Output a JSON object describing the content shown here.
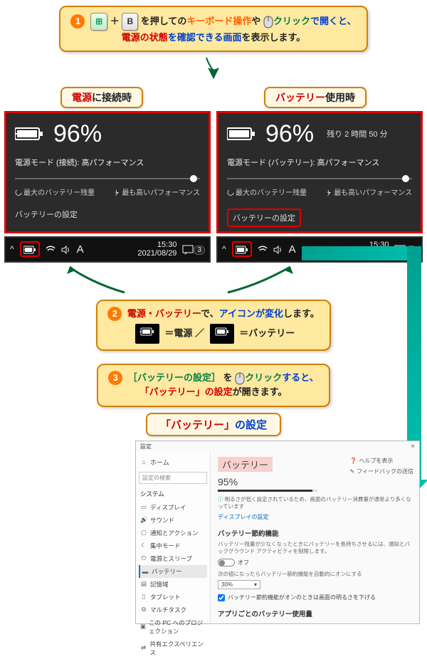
{
  "callout1": {
    "prefix": " を押しての",
    "kb_op": "キーボード操作",
    "ya": "や ",
    "click": "クリック",
    "de_open": "で開くと、",
    "line2a": "電源の状態",
    "line2b": "を確認できる画面",
    "line2c": "を表示します。"
  },
  "labels": {
    "plugged": "電源",
    "plugged_suffix": "に接続時",
    "battery": "バッテリー",
    "battery_suffix": "使用時"
  },
  "panelA": {
    "percent": "96%",
    "mode": "電源モード (接続): 高パフォーマンス",
    "left_label": "最大のバッテリー残量",
    "right_label": "最も高いパフォーマンス",
    "settings_link": "バッテリーの設定"
  },
  "panelB": {
    "percent": "96%",
    "remaining": "残り 2 時間 50 分",
    "mode": "電源モード (バッテリー): 高パフォーマンス",
    "left_label": "最大のバッテリー残量",
    "right_label": "最も高いパフォーマンス",
    "settings_link": "バッテリーの設定"
  },
  "taskbar": {
    "time": "15:30",
    "date": "2021/08/29",
    "ime": "A",
    "badge": "3"
  },
  "callout2": {
    "lead": "電源・バッテリー",
    "de": "で、",
    "icon_change": "アイコンが変化",
    "shimasu": "します。",
    "eq_power": " ＝電源  ／  ",
    "eq_batt": " ＝バッテリー"
  },
  "callout3": {
    "open_br": "［",
    "link_name": "バッテリーの設定",
    "close_br": "］",
    "wo": " を ",
    "click": "クリック",
    "suruto": "すると、",
    "line2a": "「",
    "line2b": "バッテリー",
    "line2c": "」の設定",
    "line2d": "が開きます。"
  },
  "settings_label": {
    "a": "「",
    "b": "バッテリー",
    "c": "」",
    "d": "の設定"
  },
  "settings": {
    "win_title": "設定",
    "close": "×",
    "home": "ホーム",
    "search_placeholder": "設定の検索",
    "section": "システム",
    "side_items": [
      "ディスプレイ",
      "サウンド",
      "通知とアクション",
      "集中モード",
      "電源とスリープ",
      "バッテリー",
      "記憶域",
      "タブレット",
      "マルチタスク",
      "この PC へのプロジェクション",
      "共有エクスペリエンス"
    ],
    "main_title": "バッテリー",
    "percent": "95%",
    "progress_pct": 95,
    "info_note": "明るさが低く設定されているため、画面のバッテリー消費量が通常より多くなっています",
    "display_settings_link": "ディスプレイの設定",
    "saver_head": "バッテリー節約機能",
    "saver_note": "バッテリー残量が少なくなったときにバッテリーを長持ちさせるには、通知とバックグラウンド アクティビティを制限します。",
    "toggle_off_label": "オフ",
    "auto_on_label": "次の値になったらバッテリー節約機能を自動的にオンにする",
    "dropdown_value": "30%",
    "checkbox_label": "バッテリー節約機能がオンのときは画面の明るさを下げる",
    "per_app_head": "アプリごとのバッテリー使用量",
    "help": "ヘルプを表示",
    "feedback": "フィードバックの送信"
  }
}
